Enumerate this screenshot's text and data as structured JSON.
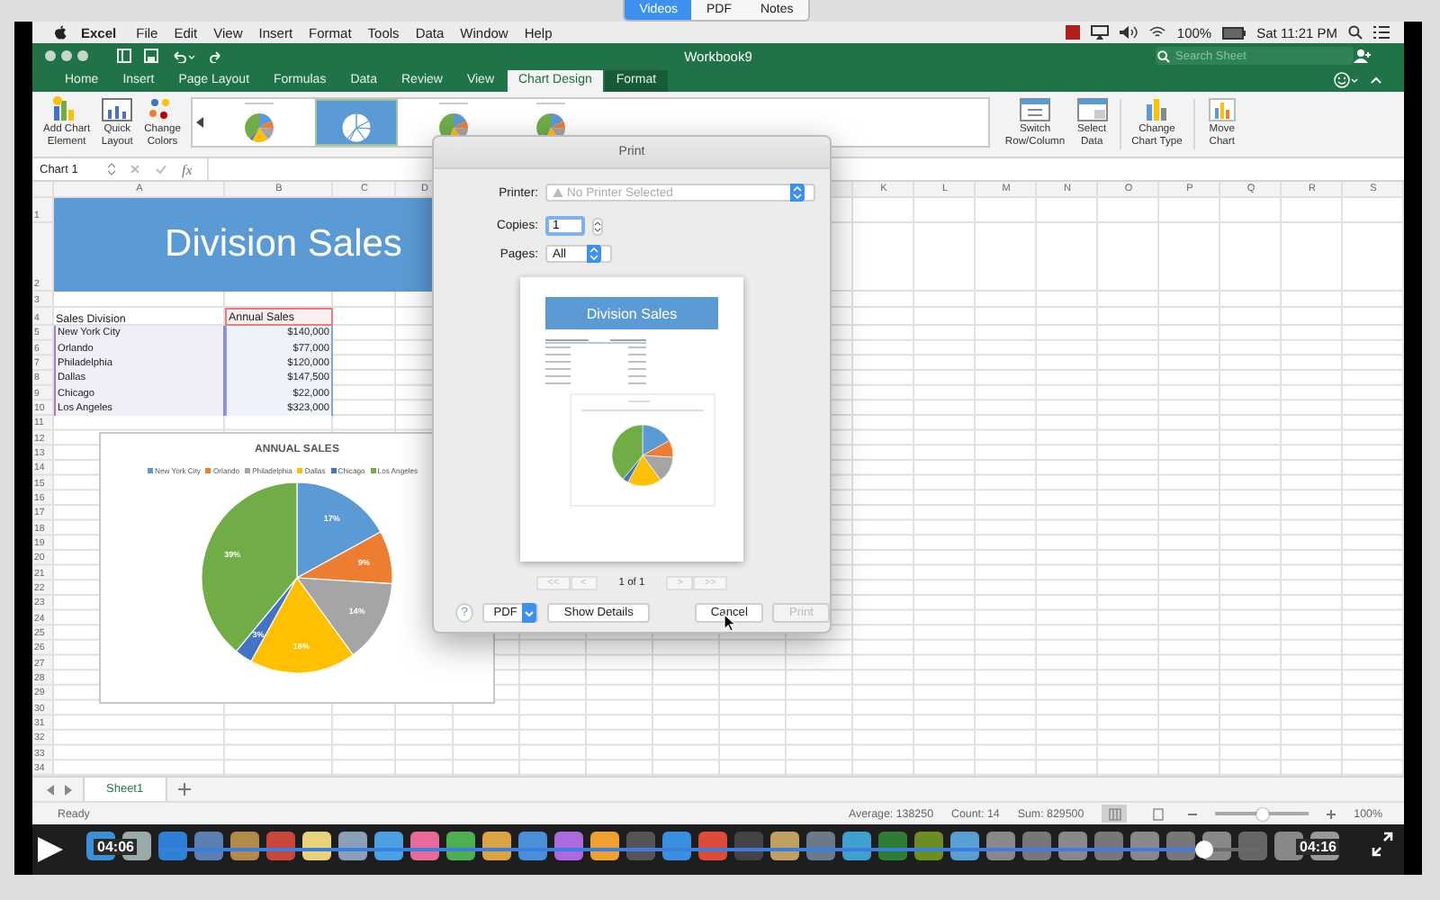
{
  "viewer_tabs": [
    {
      "label": "Videos",
      "selected": true
    },
    {
      "label": "PDF",
      "selected": false
    },
    {
      "label": "Notes",
      "selected": false
    }
  ],
  "menu_bar": {
    "app": "Excel",
    "items": [
      "File",
      "Edit",
      "View",
      "Insert",
      "Format",
      "Tools",
      "Data",
      "Window",
      "Help"
    ],
    "battery": "100%",
    "clock": "Sat 11:21 PM"
  },
  "title_bar": {
    "title": "Workbook9",
    "search": {
      "placeholder": "Search Sheet"
    }
  },
  "ribbon_tabs": [
    {
      "label": "Home",
      "selected": false,
      "kind": "normal"
    },
    {
      "label": "Insert",
      "selected": false,
      "kind": "normal"
    },
    {
      "label": "Page Layout",
      "selected": false,
      "kind": "normal"
    },
    {
      "label": "Formulas",
      "selected": false,
      "kind": "normal"
    },
    {
      "label": "Data",
      "selected": false,
      "kind": "normal"
    },
    {
      "label": "Review",
      "selected": false,
      "kind": "normal"
    },
    {
      "label": "View",
      "selected": false,
      "kind": "normal"
    },
    {
      "label": "Chart Design",
      "selected": true,
      "kind": "contextual"
    },
    {
      "label": "Format",
      "selected": false,
      "kind": "contextual"
    }
  ],
  "ribbon": {
    "left_buttons": [
      {
        "label": "Add Chart\nElement",
        "kind": "add-element"
      },
      {
        "label": "Quick\nLayout",
        "kind": "layout"
      },
      {
        "label": "Change\nColors",
        "kind": "colors"
      }
    ],
    "styles": [
      {
        "selected": false
      },
      {
        "selected": true
      },
      {
        "selected": false
      },
      {
        "selected": false
      }
    ],
    "right_buttons": [
      {
        "label": "Switch\nRow/Column",
        "kind": "switch"
      },
      {
        "label": "Select\nData",
        "kind": "select"
      },
      {
        "label": "Change\nChart Type",
        "kind": "type"
      },
      {
        "label": "Move\nChart",
        "kind": "move"
      }
    ]
  },
  "formula_bar": {
    "name_box": "Chart 1",
    "fx": "fx"
  },
  "sheet": {
    "columns": [
      "A",
      "B",
      "C",
      "D",
      "K",
      "L",
      "M",
      "N",
      "O",
      "P",
      "Q",
      "R",
      "S"
    ],
    "row_numbers": [
      "1",
      "2",
      "3",
      "4",
      "5",
      "6",
      "7",
      "8",
      "9",
      "10",
      "11",
      "12",
      "13",
      "14",
      "15",
      "16",
      "17",
      "18",
      "19",
      "20",
      "21",
      "22",
      "23",
      "24",
      "25",
      "26",
      "27",
      "28",
      "29",
      "30",
      "31",
      "32",
      "33",
      "34"
    ],
    "title": "Division Sales",
    "header": [
      "Sales Division",
      "Annual Sales"
    ],
    "rows": [
      [
        "New York City",
        "$140,000"
      ],
      [
        "Orlando",
        "$77,000"
      ],
      [
        "Philadelphia",
        "$120,000"
      ],
      [
        "Dallas",
        "$147,500"
      ],
      [
        "Chicago",
        "$22,000"
      ],
      [
        "Los Angeles",
        "$323,000"
      ]
    ],
    "chart": {
      "chart_data": {
        "type": "pie",
        "title": "ANNUAL SALES",
        "legend": "top",
        "categories": [
          "New York City",
          "Orlando",
          "Philadelphia",
          "Dallas",
          "Chicago",
          "Los Angeles"
        ],
        "values": [
          17,
          9,
          14,
          18,
          3,
          39
        ],
        "colors": [
          "#5b9bd5",
          "#ed7d31",
          "#a5a5a5",
          "#ffc000",
          "#4472c4",
          "#70ad47"
        ],
        "value_labels": [
          "17%",
          "9%",
          "14%",
          "18%",
          "3%",
          "39%"
        ]
      }
    },
    "sheet_tabs": [
      {
        "label": "Sheet1",
        "selected": true
      }
    ]
  },
  "status_bar": {
    "status": "Ready",
    "average": "Average: 138250",
    "count": "Count: 14",
    "sum": "Sum: 829500",
    "views": [
      {
        "selected": true
      },
      {
        "selected": false
      }
    ],
    "zoom": {
      "level": 0.5,
      "reading": "100%"
    }
  },
  "print_dialog": {
    "title": "Print",
    "printer": {
      "label": "Printer:",
      "value": "No Printer Selected",
      "disabled": true
    },
    "copies": {
      "label": "Copies:",
      "value": "1"
    },
    "pages": {
      "label": "Pages:",
      "value": "All"
    },
    "preview": {
      "title": "Division Sales"
    },
    "pager": {
      "buttons": [
        {
          "label": "<<",
          "disabled": true
        },
        {
          "label": "<",
          "disabled": true
        },
        {
          "label": ">",
          "disabled": true
        },
        {
          "label": ">>",
          "disabled": true
        }
      ],
      "page": "1 of 1"
    },
    "buttons": [
      {
        "label": "?",
        "kind": "help",
        "disabled": false
      },
      {
        "label": "PDF",
        "kind": "menu",
        "disabled": false
      },
      {
        "label": "Show Details",
        "kind": "normal",
        "disabled": false
      },
      {
        "label": "Cancel",
        "kind": "normal",
        "disabled": false
      },
      {
        "label": "Print",
        "kind": "normal",
        "disabled": true
      }
    ]
  },
  "video": {
    "elapsed": "04:06",
    "total": "04:16",
    "progress": {
      "level": 0.95
    }
  }
}
